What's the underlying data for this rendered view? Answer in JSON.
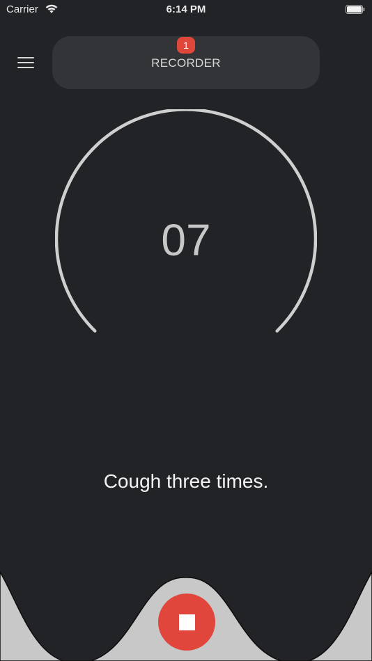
{
  "status_bar": {
    "carrier": "Carrier",
    "time": "6:14 PM",
    "icons": [
      "wifi-icon",
      "battery-icon"
    ]
  },
  "header": {
    "title": "RECORDER",
    "badge_count": "1"
  },
  "timer": {
    "countdown": "07"
  },
  "prompt": {
    "instruction": "Cough three times."
  },
  "controls": {
    "stop_icon": "stop-icon",
    "menu_icon": "hamburger-menu-icon"
  },
  "colors": {
    "background": "#222326",
    "header_pill": "#333437",
    "accent_red": "#e0463c",
    "dial_stroke": "#cfcfcf",
    "bottom_panel": "#c8c8c8"
  }
}
